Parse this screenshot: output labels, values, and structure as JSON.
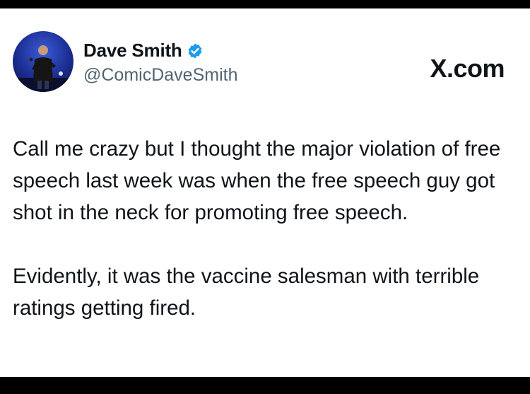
{
  "author": {
    "display_name": "Dave Smith",
    "handle": "@ComicDaveSmith",
    "avatar_icon": "profile-photo",
    "verified_icon": "verified-badge-icon",
    "verified_color": "#1d9bf0"
  },
  "brand": {
    "label": "X.com"
  },
  "post": {
    "paragraph_1": "Call me crazy but I thought the major violation of free speech last week was when the free speech guy got shot in the neck for promoting free speech.",
    "paragraph_2": "Evidently, it was the vaccine salesman with terrible ratings getting fired."
  },
  "colors": {
    "text_primary": "#0f1419",
    "text_secondary": "#536471",
    "frame": "#000000",
    "card": "#ffffff"
  }
}
